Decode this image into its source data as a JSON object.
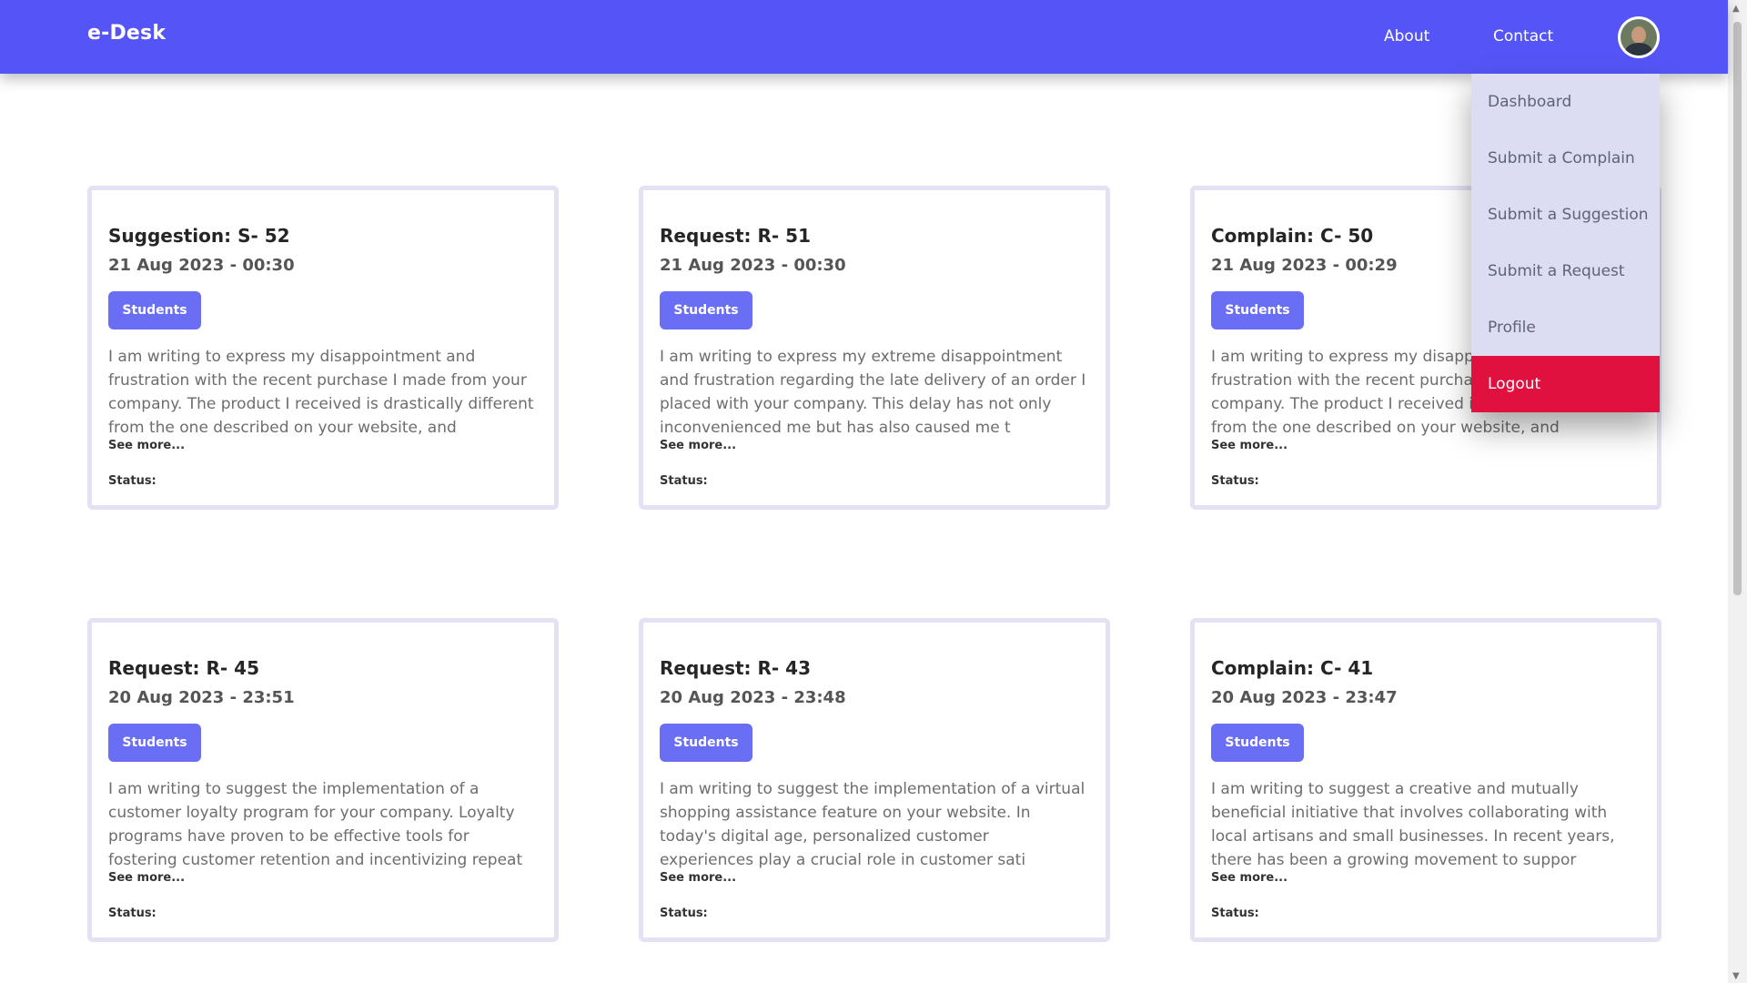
{
  "nav": {
    "brand": "e-Desk",
    "links": [
      "About",
      "Contact"
    ]
  },
  "dropdown": {
    "items": [
      "Dashboard",
      "Submit a Complain",
      "Submit a Suggestion",
      "Submit a Request",
      "Profile",
      "Logout"
    ]
  },
  "cards": [
    {
      "title": "Suggestion: S- 52",
      "date": "21 Aug 2023 - 00:30",
      "badge": "Students",
      "body": "I am writing to express my disappointment and frustration with the recent purchase I made from your company. The product I received is drastically different from the one described on your website, and",
      "see_more": "See more...",
      "status": "Status:"
    },
    {
      "title": "Request: R- 51",
      "date": "21 Aug 2023 - 00:30",
      "badge": "Students",
      "body": "I am writing to express my extreme disappointment and frustration regarding the late delivery of an order I placed with your company. This delay has not only inconvenienced me but has also caused me t",
      "see_more": "See more...",
      "status": "Status:"
    },
    {
      "title": "Complain: C- 50",
      "date": "21 Aug 2023 - 00:29",
      "badge": "Students",
      "body": "I am writing to express my disappointment and frustration with the recent purchase I made from your company. The product I received is drastically different from the one described on your website, and",
      "see_more": "See more...",
      "status": "Status:"
    },
    {
      "title": "Request: R- 45",
      "date": "20 Aug 2023 - 23:51",
      "badge": "Students",
      "body": "I am writing to suggest the implementation of a customer loyalty program for your company. Loyalty programs have proven to be effective tools for fostering customer retention and incentivizing repeat",
      "see_more": "See more...",
      "status": "Status:"
    },
    {
      "title": "Request: R- 43",
      "date": "20 Aug 2023 - 23:48",
      "badge": "Students",
      "body": "I am writing to suggest the implementation of a virtual shopping assistance feature on your website. In today's digital age, personalized customer experiences play a crucial role in customer sati",
      "see_more": "See more...",
      "status": "Status:"
    },
    {
      "title": "Complain: C- 41",
      "date": "20 Aug 2023 - 23:47",
      "badge": "Students",
      "body": "I am writing to suggest a creative and mutually beneficial initiative that involves collaborating with local artisans and small businesses. In recent years, there has been a growing movement to suppor",
      "see_more": "See more...",
      "status": "Status:"
    }
  ],
  "colors": {
    "navbar": "#5555f7",
    "badge": "#6a6ef5",
    "dropdown_bg": "#dcdcf3",
    "logout": "#e0103f",
    "card_border": "#e4e1f4"
  },
  "icons": {
    "avatar": "user-avatar",
    "scroll_up": "triangle-up",
    "scroll_down": "triangle-down"
  }
}
